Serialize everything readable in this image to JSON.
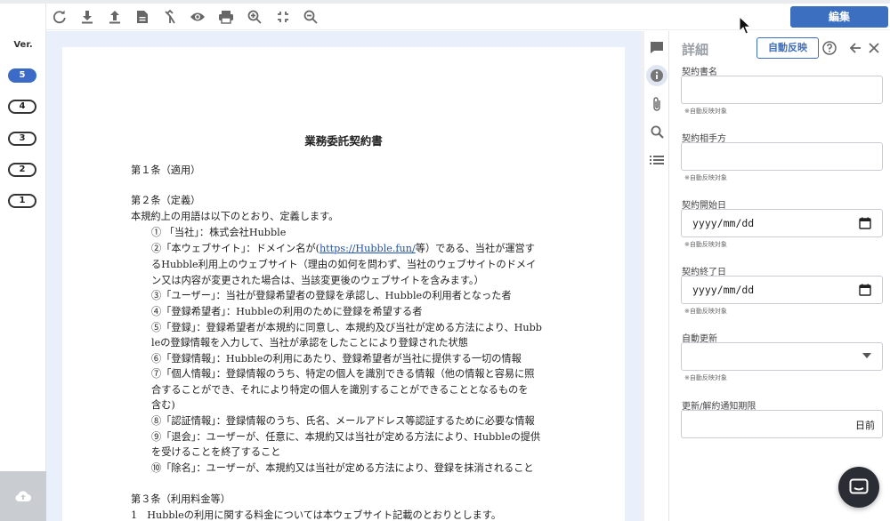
{
  "toolbar": {
    "icons": [
      "refresh-icon",
      "download-icon",
      "upload-icon",
      "document-icon",
      "merge-icon",
      "eye-icon",
      "print-icon",
      "zoom-in-icon",
      "fit-icon",
      "zoom-out-icon"
    ],
    "edit_label": "編集"
  },
  "versions": {
    "title": "Ver.",
    "items": [
      "5",
      "4",
      "3",
      "2",
      "1"
    ],
    "active": "5"
  },
  "document": {
    "title": "業務委託契約書",
    "lines": [
      "第１条（適用）",
      "第２条（定義）",
      "本規約上の用語は以下のとおり、定義します。",
      "① 「当社」：株式会社Hubble",
      "②「本ウェブサイト」：ドメイン名が(",
      "https://Hubble.fun/",
      "等）である、当社が運営す",
      "るHubble利用上のウェブサイト（理由の如何を問わず、当社のウェブサイトのドメイ",
      "ン又は内容が変更された場合は、当該変更後のウェブサイトを含みます。）",
      "③「ユーザー」：当社が登録希望者の登録を承認し、Hubbleの利用者となった者",
      "④「登録希望者」：Hubbleの利用のために登録を希望する者",
      "⑤「登録」：登録希望者が本規約に同意し、本規約及び当社が定める方法により、Hubb",
      "leの登録情報を入力して、当社が承認をしたことにより登録された状態",
      "⑥「登録情報」：Hubbleの利用にあたり、登録希望者が当社に提供する一切の情報",
      "⑦「個人情報」：登録情報のうち、特定の個人を識別できる情報（他の情報と容易に照",
      "合することができ、それにより特定の個人を識別することができることとなるものを",
      "含む)",
      "⑧「認証情報」：登録情報のうち、氏名、メールアドレス等認証するために必要な情報",
      "⑨「退会」：ユーザーが、任意に、本規約又は当社が定める方法により、Hubbleの提供",
      "を受けることを終了すること",
      "⑩「除名」：ユーザーが、本規約又は当社が定める方法により、登録を抹消されること",
      "第３条（利用料金等）",
      "1　Hubbleの利用に関する料金については本ウェブサイト記載のとおりとします。"
    ]
  },
  "sidebar_icons": [
    "comment-icon",
    "info-icon",
    "attachment-icon",
    "search-icon",
    "list-icon"
  ],
  "details": {
    "title": "詳細",
    "auto_reflect_label": "自動反映",
    "fields": [
      {
        "label": "契約書名",
        "value": "",
        "note": "※自動反映対象"
      },
      {
        "label": "契約相手方",
        "value": "",
        "note": "※自動反映対象"
      },
      {
        "label": "契約開始日",
        "value": "yyyy/mm/dd",
        "note": "※自動反映対象"
      },
      {
        "label": "契約終了日",
        "value": "yyyy/mm/dd",
        "note": "※自動反映対象"
      },
      {
        "label": "自動更新",
        "value": "",
        "note": "※自動反映対象"
      },
      {
        "label": "更新/解約通知期限",
        "value": "",
        "suffix": "日前"
      }
    ]
  },
  "colors": {
    "accent": "#3c6fbf",
    "viewer_bg": "#e9f0fb",
    "chat_bg": "#2a2d33"
  }
}
